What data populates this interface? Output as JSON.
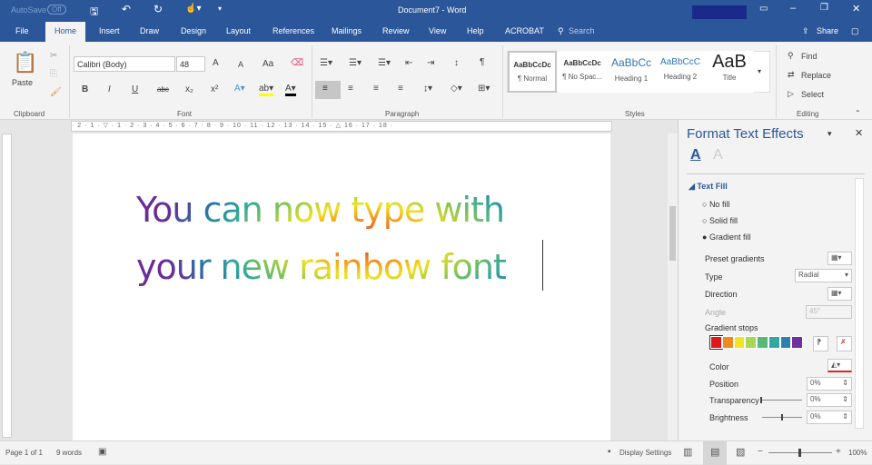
{
  "titlebar": {
    "autosave": "AutoSave",
    "autosave_state": "Off",
    "title": "Document7  -  Word"
  },
  "tabs": [
    "File",
    "Home",
    "Insert",
    "Draw",
    "Design",
    "Layout",
    "References",
    "Mailings",
    "Review",
    "View",
    "Help",
    "ACROBAT"
  ],
  "search": "Search",
  "share": "Share",
  "ribbon": {
    "clipboard": {
      "paste": "Paste",
      "label": "Clipboard"
    },
    "font": {
      "name": "Calibri (Body)",
      "size": "48",
      "label": "Font",
      "grow": "A",
      "shrink": "A",
      "case": "Aa",
      "bold": "B",
      "italic": "I",
      "underline": "U",
      "strike": "abc",
      "sub": "x₂",
      "sup": "x²"
    },
    "paragraph": {
      "label": "Paragraph"
    },
    "styles": {
      "label": "Styles",
      "items": [
        {
          "preview": "AaBbCcDc",
          "name": "¶ Normal"
        },
        {
          "preview": "AaBbCcDc",
          "name": "¶ No Spac..."
        },
        {
          "preview": "AaBbCc",
          "name": "Heading 1"
        },
        {
          "preview": "AaBbCcC",
          "name": "Heading 2"
        },
        {
          "preview": "AaB",
          "name": "Title"
        }
      ]
    },
    "editing": {
      "label": "Editing",
      "find": "Find",
      "replace": "Replace",
      "select": "Select"
    }
  },
  "ruler": "· 2 · 1 · ▽ · 1 · 2 · 3 · 4 · 5 · 6 · 7 · 8 · 9 · 10 · 11 · 12 · 13 · 14 · 15 · △ 16 · 17 · 18 ·",
  "document": {
    "lines": [
      "You can now type with",
      "your new rainbow font"
    ]
  },
  "pane": {
    "title": "Format Text Effects",
    "section": "Text Fill",
    "options": [
      "No fill",
      "Solid fill",
      "Gradient fill"
    ],
    "selected_option": "Gradient fill",
    "preset_label": "Preset gradients",
    "type_label": "Type",
    "type_value": "Radial",
    "direction_label": "Direction",
    "angle_label": "Angle",
    "angle_value": "45°",
    "stops_label": "Gradient stops",
    "stop_colors": [
      "#e01818",
      "#f08a1c",
      "#f4e428",
      "#a8d850",
      "#58b878",
      "#30a8a0",
      "#2c80b0",
      "#7030a0"
    ],
    "color_label": "Color",
    "position_label": "Position",
    "position_value": "0%",
    "transparency_label": "Transparency",
    "transparency_value": "0%",
    "brightness_label": "Brightness",
    "brightness_value": "0%"
  },
  "status": {
    "page": "Page 1 of 1",
    "words": "9 words",
    "display": "Display Settings",
    "zoom": "100%",
    "zoom_level": 100
  }
}
